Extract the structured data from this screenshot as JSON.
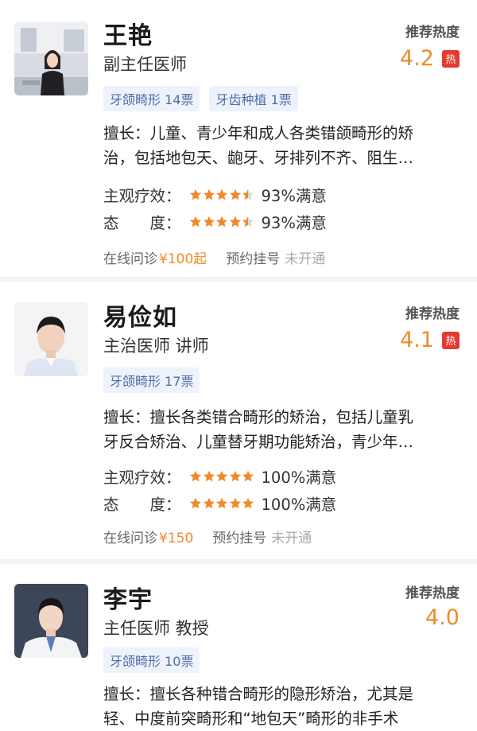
{
  "doctors": [
    {
      "name": "王艳",
      "title": "副主任医师",
      "heat_label": "推荐热度",
      "heat_value": "4.2",
      "hot_badge": "热",
      "tags": [
        "牙颌畸形 14票",
        "牙齿种植 1票"
      ],
      "specialty_lines": [
        "擅长：儿童、青少年和成人各类错颌畸形的矫",
        "治，包括地包天、龅牙、牙排列不齐、阻生…"
      ],
      "ratings": [
        {
          "label": "主观疗效：",
          "stars": 4.5,
          "text": "93%满意"
        },
        {
          "label": "态　　度：",
          "stars": 4.5,
          "text": "93%满意"
        }
      ],
      "online_label": "在线问诊",
      "online_price": "¥100起",
      "appointment_label": "预约挂号",
      "appointment_status": "未开通"
    },
    {
      "name": "易俭如",
      "title": "主治医师 讲师",
      "heat_label": "推荐热度",
      "heat_value": "4.1",
      "hot_badge": "热",
      "tags": [
        "牙颌畸形 17票"
      ],
      "specialty_lines": [
        "擅长：擅长各类错合畸形的矫治，包括儿童乳",
        "牙反合矫治、儿童替牙期功能矫治，青少年…"
      ],
      "ratings": [
        {
          "label": "主观疗效：",
          "stars": 5,
          "text": "100%满意"
        },
        {
          "label": "态　　度：",
          "stars": 5,
          "text": "100%满意"
        }
      ],
      "online_label": "在线问诊",
      "online_price": "¥150",
      "appointment_label": "预约挂号",
      "appointment_status": "未开通"
    },
    {
      "name": "李宇",
      "title": "主任医师 教授",
      "heat_label": "推荐热度",
      "heat_value": "4.0",
      "tags": [
        "牙颌畸形 10票"
      ],
      "specialty_lines": [
        "擅长：擅长各种错合畸形的隐形矫治，尤其是",
        "轻、中度前突畸形和“地包天”畸形的非手术"
      ]
    }
  ],
  "colors": {
    "accent": "#ef8a2a",
    "hot": "#e53a2f",
    "tag_text": "#4e6da8",
    "tag_bg": "#eef2fb"
  },
  "icons": {
    "star": "star-icon",
    "hot": "hot-badge"
  }
}
